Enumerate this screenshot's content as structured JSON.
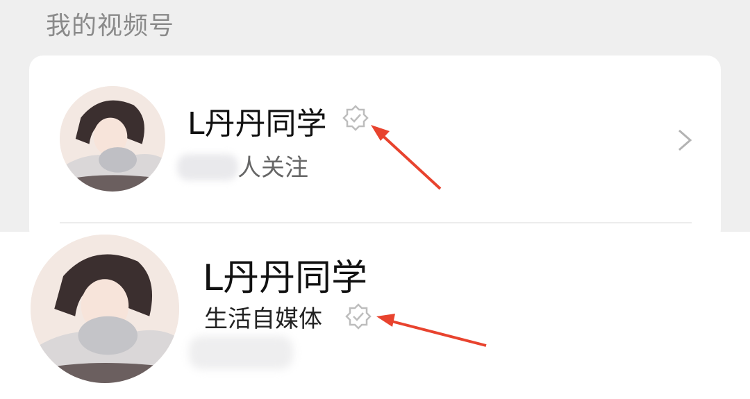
{
  "section": {
    "title": "我的视频号"
  },
  "account_card": {
    "name": "L丹丹同学",
    "followers_suffix": "人关注",
    "verified_icon": "verified-badge-icon",
    "chevron_icon": "chevron-right-icon"
  },
  "profile_header": {
    "name": "L丹丹同学",
    "subtitle": "生活自媒体",
    "verified_icon": "verified-badge-icon"
  },
  "annotations": {
    "arrow_color": "#e8432e"
  }
}
